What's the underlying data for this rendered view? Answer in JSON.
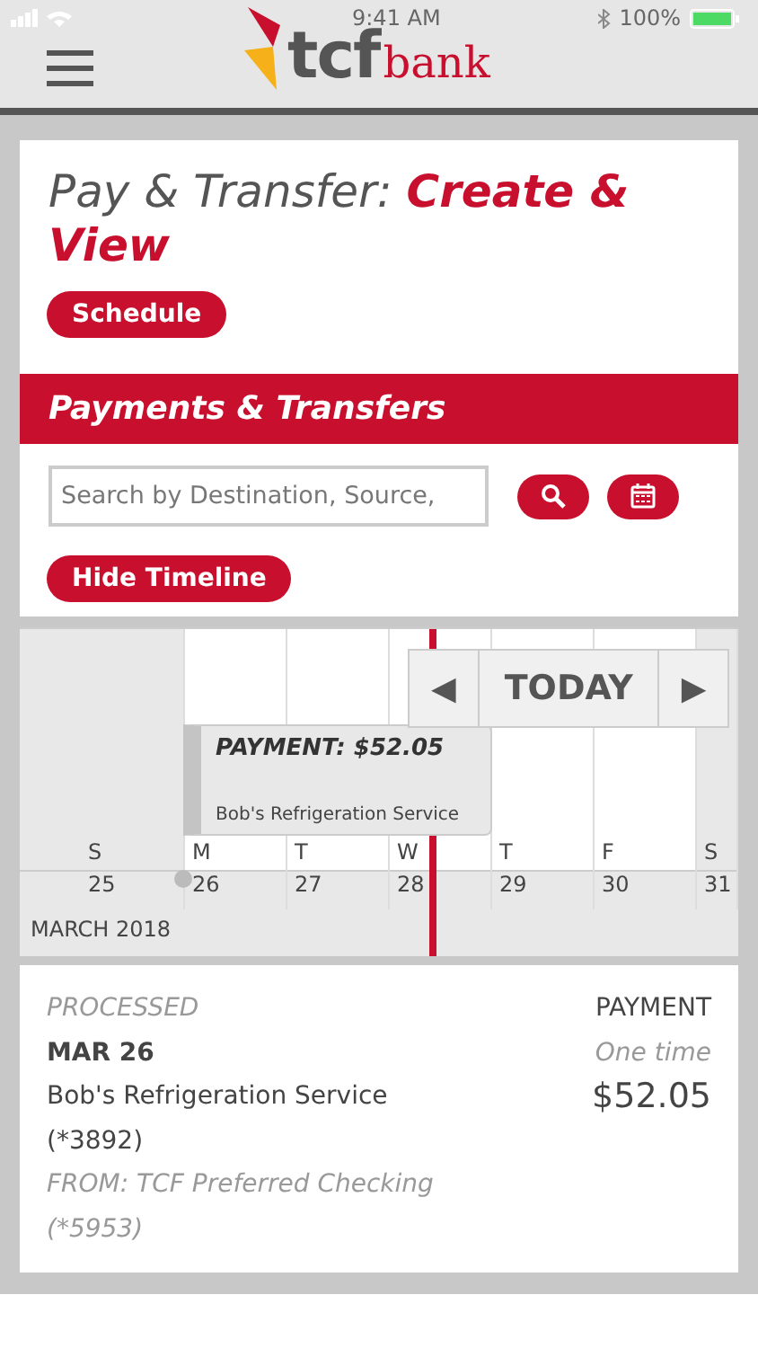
{
  "status_bar": {
    "time": "9:41 AM",
    "battery": "100%"
  },
  "header": {
    "logo_main": "tcf",
    "logo_sub": "bank"
  },
  "title": {
    "prefix": "Pay & Transfer: ",
    "highlight": "Create & View"
  },
  "schedule_button": "Schedule",
  "section_title": "Payments & Transfers",
  "search": {
    "placeholder": "Search by Destination, Source,"
  },
  "hide_timeline_button": "Hide Timeline",
  "timeline": {
    "nav": {
      "prev": "◀",
      "today": "TODAY",
      "next": "▶"
    },
    "days": [
      {
        "letter": "S",
        "date": "25",
        "weekend": true
      },
      {
        "letter": "M",
        "date": "26",
        "weekend": false
      },
      {
        "letter": "T",
        "date": "27",
        "weekend": false
      },
      {
        "letter": "W",
        "date": "28",
        "weekend": false
      },
      {
        "letter": "T",
        "date": "29",
        "weekend": false
      },
      {
        "letter": "F",
        "date": "30",
        "weekend": false
      },
      {
        "letter": "S",
        "date": "31",
        "weekend": true
      }
    ],
    "month": "MARCH 2018",
    "event": {
      "title": "PAYMENT: $52.05",
      "payee": "Bob's Refrigeration Service"
    }
  },
  "transaction": {
    "status": "PROCESSED",
    "date": "MAR 26",
    "payee": "Bob's Refrigeration Service",
    "payee_account": "(*3892)",
    "from": "FROM: TCF Preferred Checking",
    "from_account": "(*5953)",
    "type": "PAYMENT",
    "frequency": "One time",
    "amount": "$52.05"
  }
}
